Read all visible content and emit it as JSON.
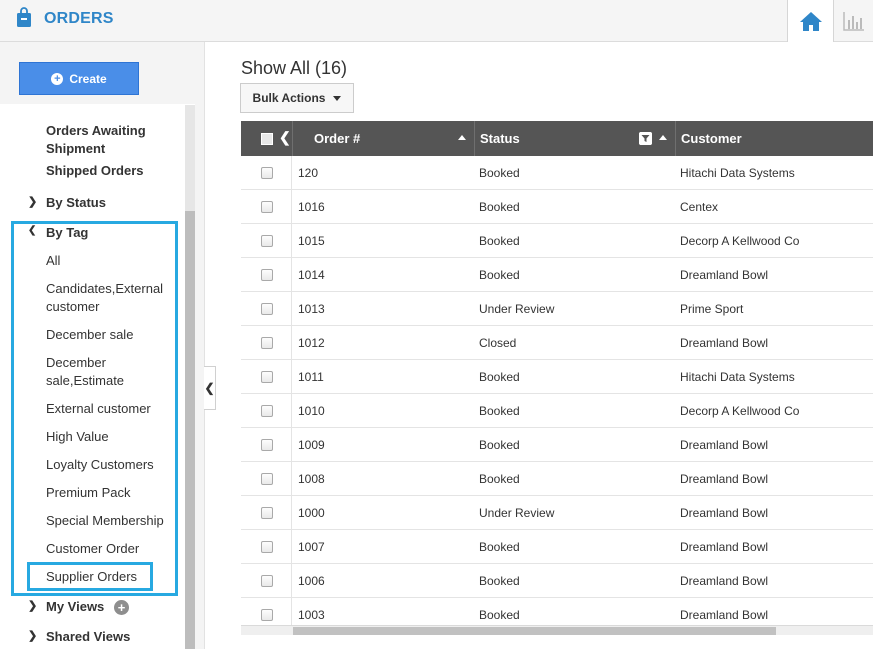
{
  "header": {
    "app_title": "ORDERS",
    "logo_icon": "shopping-bag-icon",
    "home_icon": "home-icon",
    "reports_icon": "bar-chart-icon",
    "accent_color": "#2f86c8"
  },
  "sidebar": {
    "create_label": "Create",
    "items": [
      {
        "label": "Orders Awaiting",
        "label2": "Shipment"
      },
      {
        "label": "Shipped Orders"
      },
      {
        "label": "By Status"
      },
      {
        "label": "By Tag"
      }
    ],
    "tags": [
      {
        "label": "All"
      },
      {
        "label": "Candidates,External",
        "label2": "customer"
      },
      {
        "label": "December sale"
      },
      {
        "label": "December",
        "label2": "sale,Estimate"
      },
      {
        "label": "External customer"
      },
      {
        "label": "High Value"
      },
      {
        "label": "Loyalty Customers"
      },
      {
        "label": "Premium Pack"
      },
      {
        "label": "Special Membership"
      },
      {
        "label": "Customer Order"
      },
      {
        "label": "Supplier Orders"
      }
    ],
    "my_views": "My Views",
    "shared_views": "Shared Views",
    "highlight_color": "#27a9e1"
  },
  "main": {
    "heading": "Show All (16)",
    "bulk_actions": "Bulk Actions",
    "columns": {
      "order": "Order #",
      "status": "Status",
      "customer": "Customer"
    },
    "rows": [
      {
        "order": "120",
        "status": "Booked",
        "customer": "Hitachi Data Systems"
      },
      {
        "order": "1016",
        "status": "Booked",
        "customer": "Centex"
      },
      {
        "order": "1015",
        "status": "Booked",
        "customer": "Decorp A Kellwood Co"
      },
      {
        "order": "1014",
        "status": "Booked",
        "customer": "Dreamland Bowl"
      },
      {
        "order": "1013",
        "status": "Under Review",
        "customer": "Prime Sport"
      },
      {
        "order": "1012",
        "status": "Closed",
        "customer": "Dreamland Bowl"
      },
      {
        "order": "1011",
        "status": "Booked",
        "customer": "Hitachi Data Systems"
      },
      {
        "order": "1010",
        "status": "Booked",
        "customer": "Decorp A Kellwood Co"
      },
      {
        "order": "1009",
        "status": "Booked",
        "customer": "Dreamland Bowl"
      },
      {
        "order": "1008",
        "status": "Booked",
        "customer": "Dreamland Bowl"
      },
      {
        "order": "1000",
        "status": "Under Review",
        "customer": "Dreamland Bowl"
      },
      {
        "order": "1007",
        "status": "Booked",
        "customer": "Dreamland Bowl"
      },
      {
        "order": "1006",
        "status": "Booked",
        "customer": "Dreamland Bowl"
      },
      {
        "order": "1003",
        "status": "Booked",
        "customer": "Dreamland Bowl"
      }
    ]
  }
}
